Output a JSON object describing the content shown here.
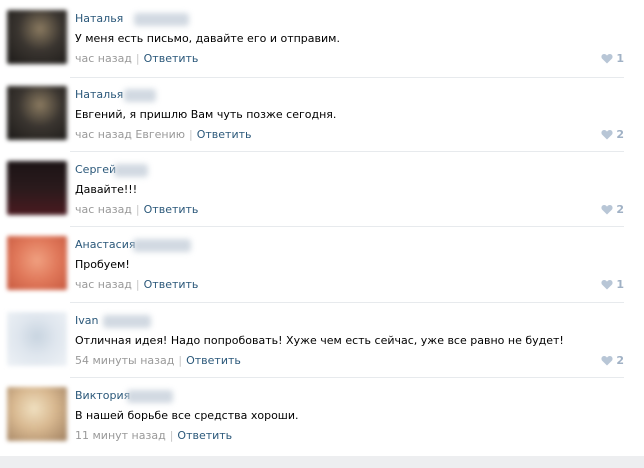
{
  "comments": [
    {
      "author": "Наталья",
      "text": "У меня есть письмо, давайте его и отправим.",
      "time": "час назад",
      "addressee": "",
      "reply": "Ответить",
      "likes": "1",
      "avatar_color": "#3a3530"
    },
    {
      "author": "Наталья",
      "text": "Евгений, я пришлю Вам чуть позже сегодня.",
      "time": "час назад Евгению",
      "addressee": "",
      "reply": "Ответить",
      "likes": "2",
      "avatar_color": "#3a3530"
    },
    {
      "author": "Сергей",
      "text": "Давайте!!!",
      "time": "час назад",
      "addressee": "",
      "reply": "Ответить",
      "likes": "2",
      "avatar_color": "#2a1a1c"
    },
    {
      "author": "Анастасия",
      "text": "Пробуем!",
      "time": "час назад",
      "addressee": "",
      "reply": "Ответить",
      "likes": "1",
      "avatar_color": "#e0785a"
    },
    {
      "author": "Ivan",
      "text": "Отличная идея! Надо попробовать! Хуже чем есть сейчас, уже все равно не будет!",
      "time": "54 минуты назад",
      "addressee": "",
      "reply": "Ответить",
      "likes": "2",
      "avatar_color": "#dfe6ee"
    },
    {
      "author": "Виктория",
      "text": "В нашей борьбе все средства хороши.",
      "time": "11 минут назад",
      "addressee": "",
      "reply": "Ответить",
      "likes": "",
      "avatar_color": "#d8b890"
    }
  ],
  "colors": {
    "link": "#2b587a",
    "meta": "#999999",
    "like": "#a0b1c5"
  }
}
